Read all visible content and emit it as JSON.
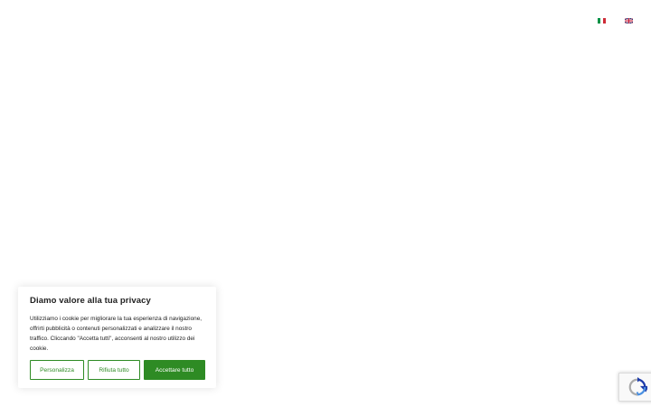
{
  "languages": [
    {
      "code": "it",
      "icon": "italy-flag-icon"
    },
    {
      "code": "en",
      "icon": "uk-flag-icon"
    }
  ],
  "cookie_banner": {
    "title": "Diamo valore alla tua privacy",
    "text": "Utilizziamo i cookie per migliorare la tua esperienza di navigazione, offrirti pubblicità o contenuti personalizzati e analizzare il nostro traffico. Cliccando \"Accetta tutti\", acconsenti al nostro utilizzo dei cookie.",
    "customize_label": "Personalizza",
    "reject_label": "Rifiuta tutto",
    "accept_label": "Accettare tutto"
  },
  "colors": {
    "accent": "#2e8b24",
    "text": "#212121"
  },
  "recaptcha": {
    "icon": "recaptcha-icon"
  }
}
